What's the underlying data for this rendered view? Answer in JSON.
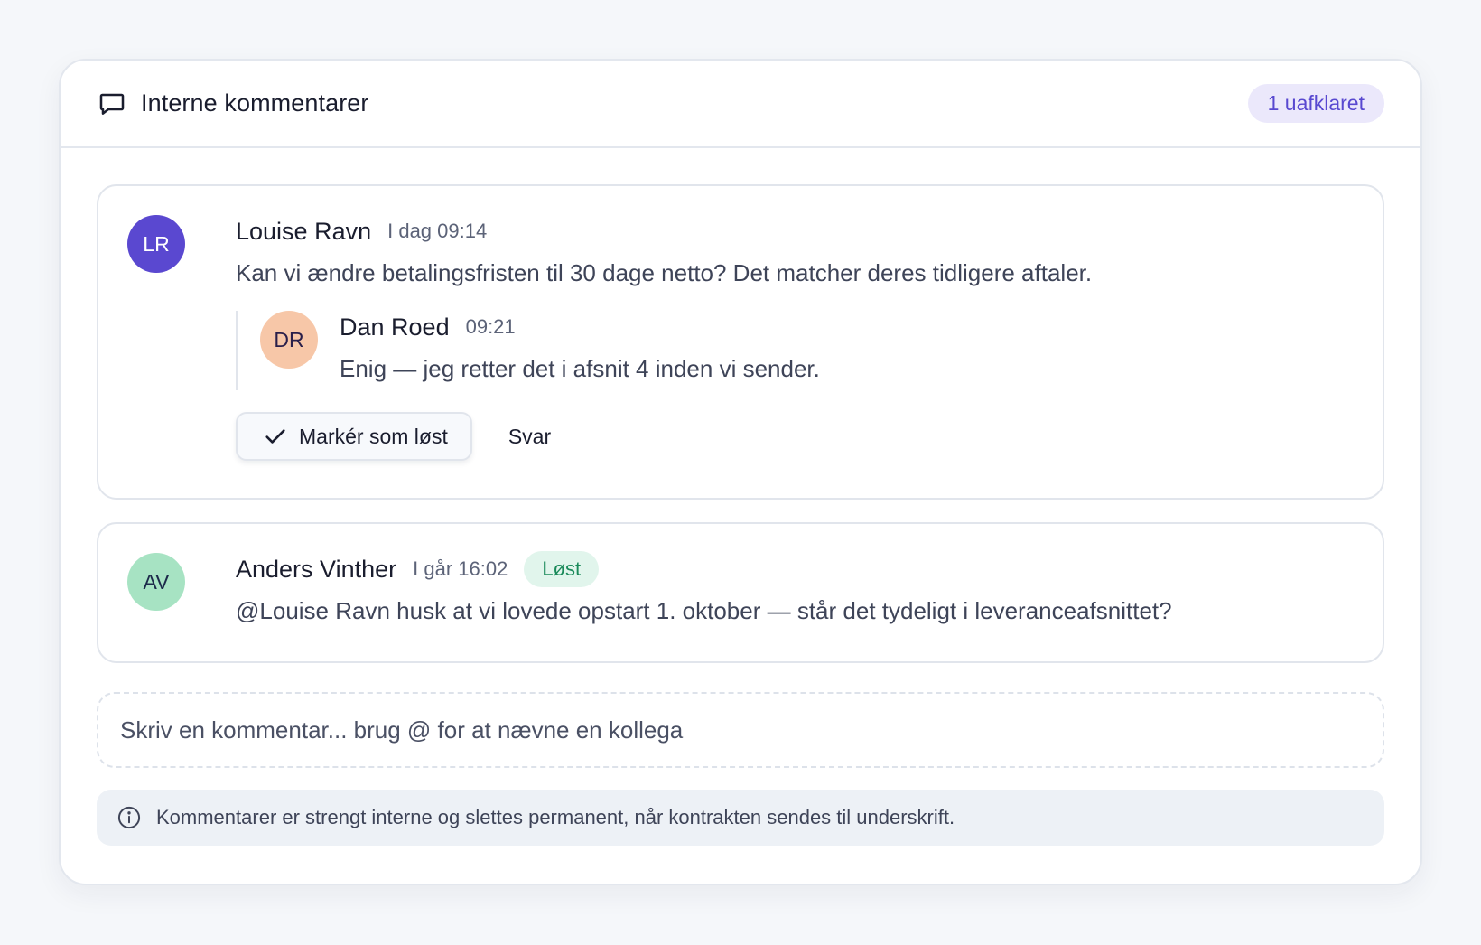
{
  "header": {
    "title": "Interne kommentarer",
    "icon": "message-square-icon",
    "unresolved_badge": "1 uafklaret"
  },
  "comments": [
    {
      "initials": "LR",
      "avatar_color": "#5a48d0",
      "author": "Louise Ravn",
      "time": "I dag 09:14",
      "text": "Kan vi ændre betalingsfristen til 30 dage netto? Det matcher deres tidligere aftaler.",
      "reply": {
        "initials": "DR",
        "avatar_color": "#f7c7a8",
        "author": "Dan Roed",
        "time": "09:21",
        "text": "Enig — jeg retter det i afsnit 4 inden vi sender."
      },
      "actions": {
        "resolve_label": "Markér som løst",
        "resolve_icon": "check-icon",
        "reply_label": "Svar"
      }
    },
    {
      "initials": "AV",
      "avatar_color": "#a7e3c3",
      "author": "Anders Vinther",
      "time": "I går 16:02",
      "status_badge": "Løst",
      "text": "@Louise Ravn husk at vi lovede opstart 1. oktober — står det tydeligt i leveranceafsnittet?"
    }
  ],
  "composer": {
    "placeholder": "Skriv en kommentar... brug @ for at nævne en kollega",
    "value": ""
  },
  "notice": {
    "icon": "info-icon",
    "text": "Kommentarer er strengt interne og slettes permanent, når kontrakten sendes til underskrift."
  },
  "colors": {
    "accent": "#5a48d0",
    "unresolved_badge_bg": "#ebe8fb",
    "resolved_badge_bg": "#e1f5ec",
    "resolved_badge_text": "#1a8a5a"
  }
}
